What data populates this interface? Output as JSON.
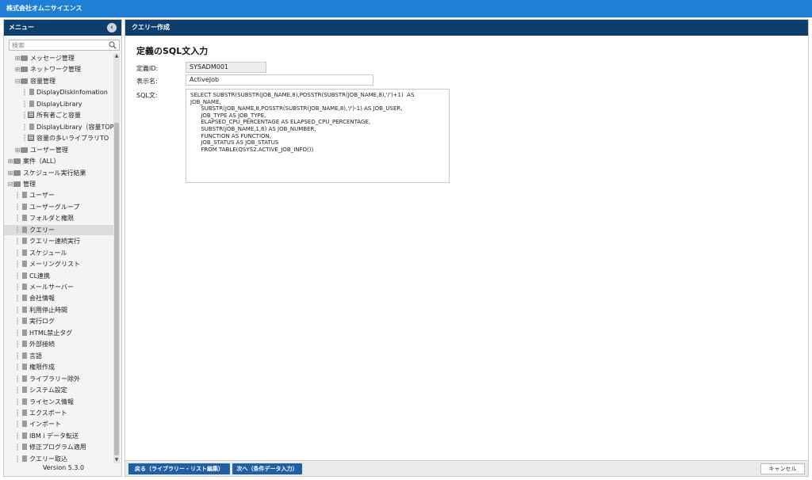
{
  "app": {
    "title": "株式会社オムニサイエンス"
  },
  "sidebar": {
    "header": "メニュー",
    "search_placeholder": "検索",
    "version": "Version 5.3.0",
    "tree": [
      {
        "label": "メッセージ管理",
        "type": "folder",
        "toggle": "+"
      },
      {
        "label": "ネットワーク管理",
        "type": "folder",
        "toggle": "+"
      },
      {
        "label": "容量管理",
        "type": "folder",
        "toggle": "−"
      },
      {
        "label": "DisplayDiskInfomation",
        "type": "doc"
      },
      {
        "label": "DisplayLibrary",
        "type": "doc"
      },
      {
        "label": "所有者ごと容量",
        "type": "grid"
      },
      {
        "label": "DisplayLibrary（容量TOP",
        "type": "doc"
      },
      {
        "label": "容量の多いライブラリTO",
        "type": "grid"
      },
      {
        "label": "ユーザー管理",
        "type": "folder",
        "toggle": "+"
      },
      {
        "label": "案件（ALL）",
        "type": "folder",
        "toggle": "+"
      },
      {
        "label": "スケジュール実行結果",
        "type": "folder",
        "toggle": "+"
      },
      {
        "label": "管理",
        "type": "folder",
        "toggle": "−"
      },
      {
        "label": "ユーザー",
        "type": "doc"
      },
      {
        "label": "ユーザーグループ",
        "type": "doc"
      },
      {
        "label": "フォルダと権限",
        "type": "doc"
      },
      {
        "label": "クエリー",
        "type": "doc",
        "selected": true
      },
      {
        "label": "クエリー連続実行",
        "type": "doc"
      },
      {
        "label": "スケジュール",
        "type": "doc"
      },
      {
        "label": "メーリングリスト",
        "type": "doc"
      },
      {
        "label": "CL連携",
        "type": "doc"
      },
      {
        "label": "メールサーバー",
        "type": "doc"
      },
      {
        "label": "会社情報",
        "type": "doc"
      },
      {
        "label": "利用停止時間",
        "type": "doc"
      },
      {
        "label": "実行ログ",
        "type": "doc"
      },
      {
        "label": "HTML禁止タグ",
        "type": "doc"
      },
      {
        "label": "外部接続",
        "type": "doc"
      },
      {
        "label": "言語",
        "type": "doc"
      },
      {
        "label": "権限作成",
        "type": "doc"
      },
      {
        "label": "ライブラリー除外",
        "type": "doc"
      },
      {
        "label": "システム設定",
        "type": "doc"
      },
      {
        "label": "ライセンス情報",
        "type": "doc"
      },
      {
        "label": "エクスポート",
        "type": "doc"
      },
      {
        "label": "インポート",
        "type": "doc"
      },
      {
        "label": "IBM i データ転送",
        "type": "doc"
      },
      {
        "label": "修正プログラム適用",
        "type": "doc"
      },
      {
        "label": "クエリー取込",
        "type": "doc"
      }
    ]
  },
  "main": {
    "header": "クエリー作成",
    "page_title": "定義のSQL文入力",
    "id_label": "定義ID:",
    "id_value": "SYSADM001",
    "name_label": "表示名:",
    "name_value": "ActiveJob",
    "sql_label": "SQL文:",
    "sql_lines": [
      "SELECT SUBSTR(SUBSTR(JOB_NAME,8),POSSTR(SUBSTR(JOB_NAME,8),'/')+1)  AS",
      "JOB_NAME,",
      "      SUBSTR(JOB_NAME,8,POSSTR(SUBSTR(JOB_NAME,8),'/')-1) AS JOB_USER,",
      "      JOB_TYPE AS JOB_TYPE,",
      "      ELAPSED_CPU_PERCENTAGE AS ELAPSED_CPU_PERCENTAGE,",
      "      SUBSTR(JOB_NAME,1,6) AS JOB_NUMBER,",
      "      FUNCTION AS FUNCTION,",
      "      JOB_STATUS AS JOB_STATUS",
      "      FROM TABLE(QSYS2.ACTIVE_JOB_INFO())"
    ],
    "buttons": {
      "back": "戻る（ライブラリー・リスト編集）",
      "next": "次へ（条件データ入力）",
      "cancel": "キャンセル"
    }
  }
}
